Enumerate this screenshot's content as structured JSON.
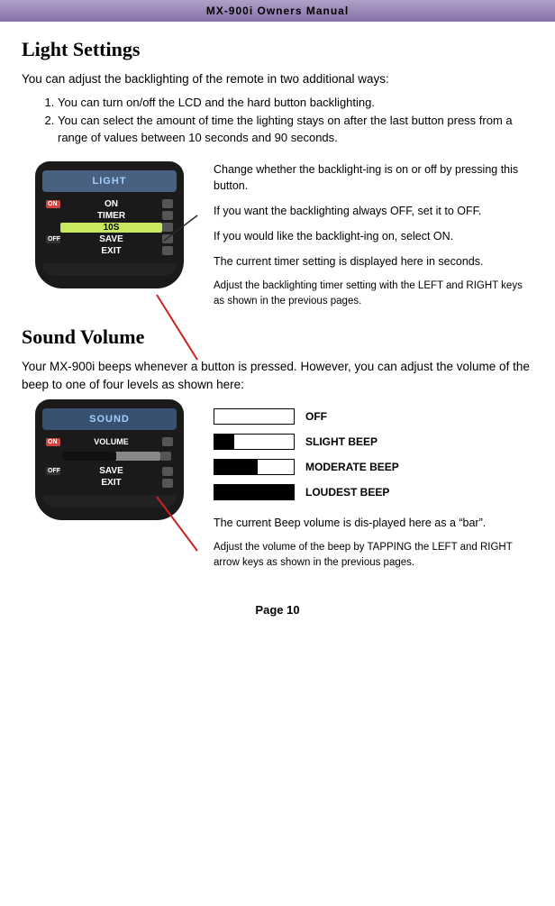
{
  "header": {
    "title": "MX-900i Owners Manual"
  },
  "light_section": {
    "title": "Light Settings",
    "intro": "You can adjust the backlighting of the remote in two additional ways:",
    "list_items": [
      "You can turn on/off the LCD and the hard button backlighting.",
      "You can select the amount of time the lighting stays on after the last button press from a range of values between 10 seconds and 90 seconds."
    ],
    "remote": {
      "screen_label": "LIGHT",
      "menu_items": [
        "ON",
        "TIMER",
        "10S",
        "SAVE",
        "EXIT"
      ],
      "on_label": "ON",
      "off_label": "OFF"
    },
    "annotations": [
      "Change whether the backlight-ing is on or off by pressing this button.",
      "If you want the backlighting always OFF, set it to OFF.",
      "If you would like the backlight-ing on, select ON.",
      "The current timer setting is displayed here in seconds.",
      "Adjust the backlighting timer setting with the LEFT and RIGHT keys as shown in the previous pages."
    ]
  },
  "sound_section": {
    "title": "Sound Volume",
    "intro": "Your MX-900i beeps whenever a button is pressed. However, you can adjust the volume of the beep to one of four levels as shown here:",
    "remote": {
      "screen_label": "SOUND",
      "submenu": "VOLUME",
      "on_label": "ON",
      "off_label": "OFF",
      "menu_items": [
        "SAVE",
        "EXIT"
      ]
    },
    "volume_levels": [
      {
        "label": "OFF",
        "fill_percent": 0
      },
      {
        "label": "SLIGHT BEEP",
        "fill_percent": 25
      },
      {
        "label": "MODERATE BEEP",
        "fill_percent": 55
      },
      {
        "label": "LOUDEST BEEP",
        "fill_percent": 100
      }
    ],
    "annotations": [
      "The current Beep volume is dis-played here as a “bar”.",
      "Adjust the volume of the beep by TAPPING the LEFT and RIGHT arrow keys as shown in the previous pages."
    ]
  },
  "footer": {
    "page_label": "Page 10"
  }
}
